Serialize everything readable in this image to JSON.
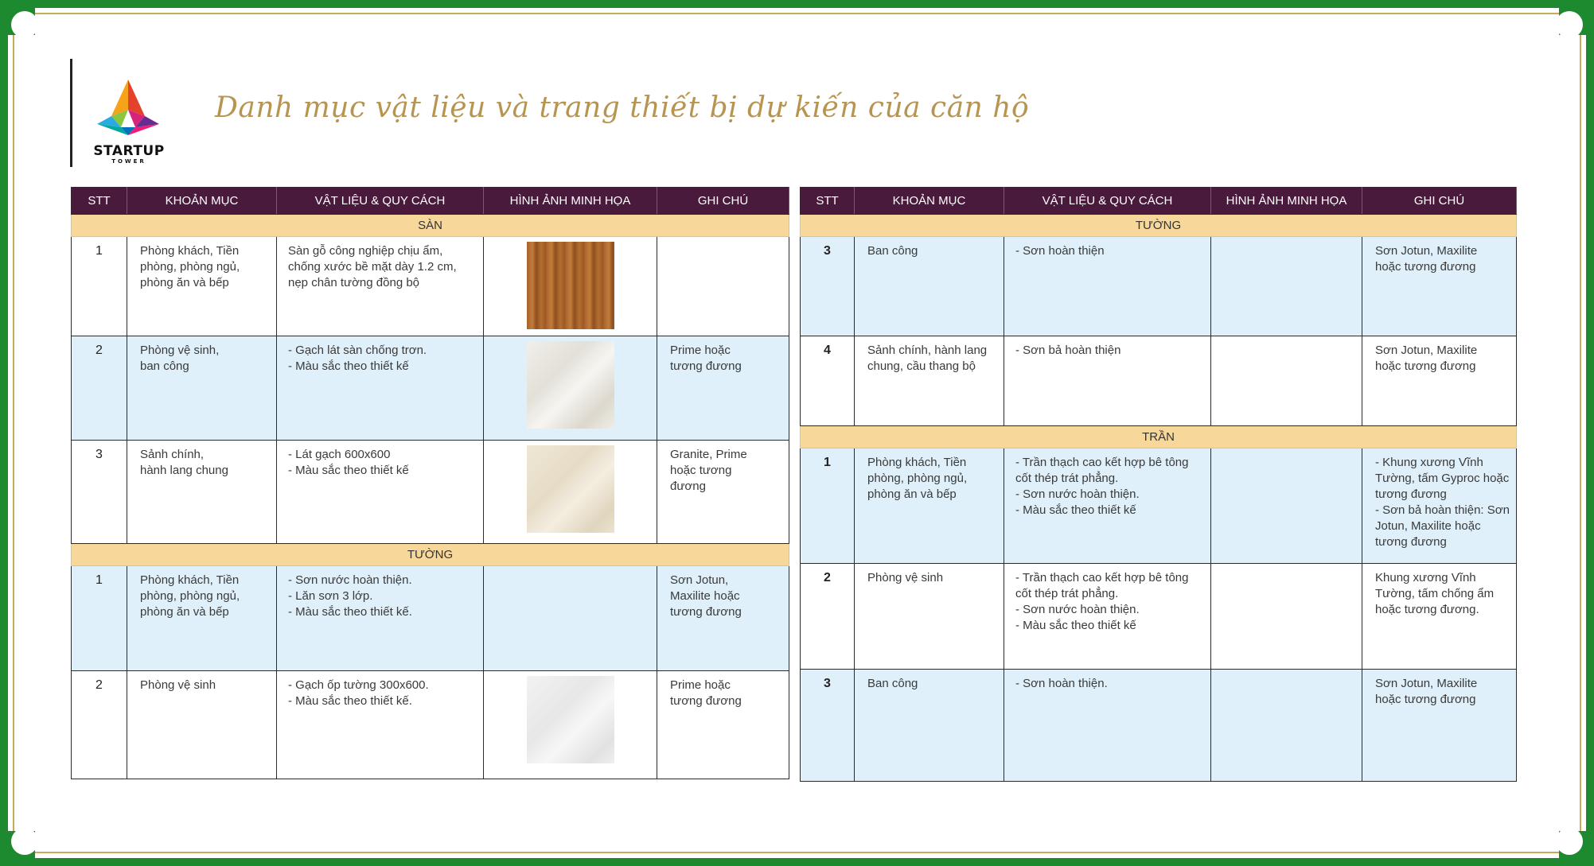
{
  "title": "Danh mục vật liệu và trang thiết bị dự kiến của căn hộ",
  "logo": {
    "name": "STARTUP",
    "sub": "TOWER"
  },
  "headers": [
    "STT",
    "KHOẢN MỤC",
    "VẬT LIỆU & QUY CÁCH",
    "HÌNH ẢNH MINH HỌA",
    "GHI CHÚ"
  ],
  "left": {
    "san": "SÀN",
    "san_rows": [
      {
        "stt": "1",
        "item": "Phòng khách, Tiền\nphòng, phòng ngủ,\nphòng ăn và bếp",
        "spec": "Sàn gỗ công nghiệp chịu ẩm,\nchống xước bề mặt dày 1.2 cm,\nnẹp chân tường đồng bộ",
        "image": "wood-floor",
        "note": ""
      },
      {
        "stt": "2",
        "item": "Phòng vệ sinh,\nban công",
        "spec": "- Gạch lát sàn chống trơn.\n- Màu sắc theo thiết kế",
        "image": "anti-slip-tile",
        "note": "Prime hoặc\ntương đương"
      },
      {
        "stt": "3",
        "item": "Sảnh chính,\nhành lang chung",
        "spec": "- Lát gạch 600x600\n- Màu sắc theo thiết kế",
        "image": "granite-tile",
        "note": "Granite, Prime\nhoặc tương\nđương"
      }
    ],
    "tuong": "TƯỜNG",
    "tuong_rows": [
      {
        "stt": "1",
        "item": "Phòng khách, Tiền\nphòng, phòng ngủ,\nphòng ăn và bếp",
        "spec": " - Sơn nước hoàn thiện.\n- Lăn sơn 3 lớp.\n- Màu sắc theo thiết kế.",
        "image": "",
        "note": "Sơn Jotun,\nMaxilite hoặc\ntương đương"
      },
      {
        "stt": "2",
        "item": "Phòng vệ sinh",
        "spec": "- Gạch ốp tường 300x600.\n- Màu sắc theo thiết kế.",
        "image": "wall-tile",
        "note": "Prime hoặc\ntương đương"
      }
    ]
  },
  "right": {
    "tuong": "TƯỜNG",
    "tuong_rows": [
      {
        "stt": "3",
        "item": "Ban công",
        "spec": "- Sơn hoàn thiện",
        "note": "Sơn Jotun, Maxilite\nhoặc tương đương"
      },
      {
        "stt": "4",
        "item": "Sảnh chính, hành lang\nchung, cầu thang bộ",
        "spec": "- Sơn bả hoàn thiện",
        "note": "Sơn Jotun, Maxilite\nhoặc tương đương"
      }
    ],
    "tran": "TRẦN",
    "tran_rows": [
      {
        "stt": "1",
        "item": "Phòng khách, Tiền\nphòng, phòng ngủ,\nphòng ăn và bếp",
        "spec": "- Trần thạch cao kết hợp bê tông\ncốt thép trát phẳng.\n- Sơn nước hoàn thiện.\n- Màu sắc theo thiết kế",
        "note": "- Khung xương Vĩnh\nTường, tấm Gyproc hoặc\ntương đương\n- Sơn bả hoàn thiện: Sơn\nJotun, Maxilite hoặc\ntương đương"
      },
      {
        "stt": "2",
        "item": "Phòng vệ sinh",
        "spec": "- Trần thạch cao kết hợp bê tông\ncốt thép trát phẳng.\n- Sơn nước hoàn thiện.\n- Màu sắc theo thiết kế",
        "note": "Khung xương Vĩnh\nTường, tấm chống ẩm\nhoặc tương đương."
      },
      {
        "stt": "3",
        "item": "Ban công",
        "spec": "- Sơn hoàn thiện.",
        "note": "Sơn Jotun, Maxilite\nhoặc tương đương"
      }
    ]
  }
}
